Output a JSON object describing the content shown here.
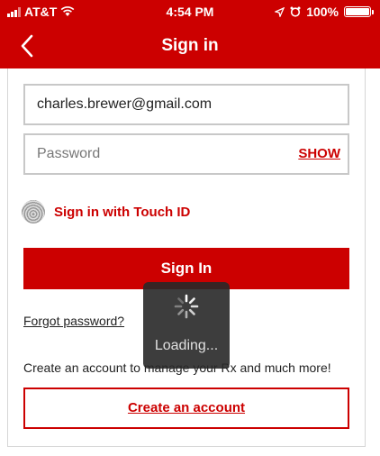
{
  "status_bar": {
    "carrier": "AT&T",
    "time": "4:54 PM",
    "battery": "100%",
    "icons": [
      "signal-icon",
      "wifi-icon",
      "location-icon",
      "alarm-icon",
      "battery-icon"
    ]
  },
  "nav": {
    "title": "Sign in",
    "back_icon": "chevron-left-icon"
  },
  "form": {
    "email_value": "charles.brewer@gmail.com",
    "password_placeholder": "Password",
    "show_label": "SHOW",
    "touch_id_label": "Sign in with Touch ID",
    "sign_in_label": "Sign In",
    "forgot_label": "Forgot password?",
    "account_prompt": "Create an account to manage your Rx and much more!",
    "create_account_label": "Create an account"
  },
  "loading": {
    "text": "Loading..."
  },
  "colors": {
    "brand_red": "#cc0000",
    "hud_background": "#282828"
  }
}
